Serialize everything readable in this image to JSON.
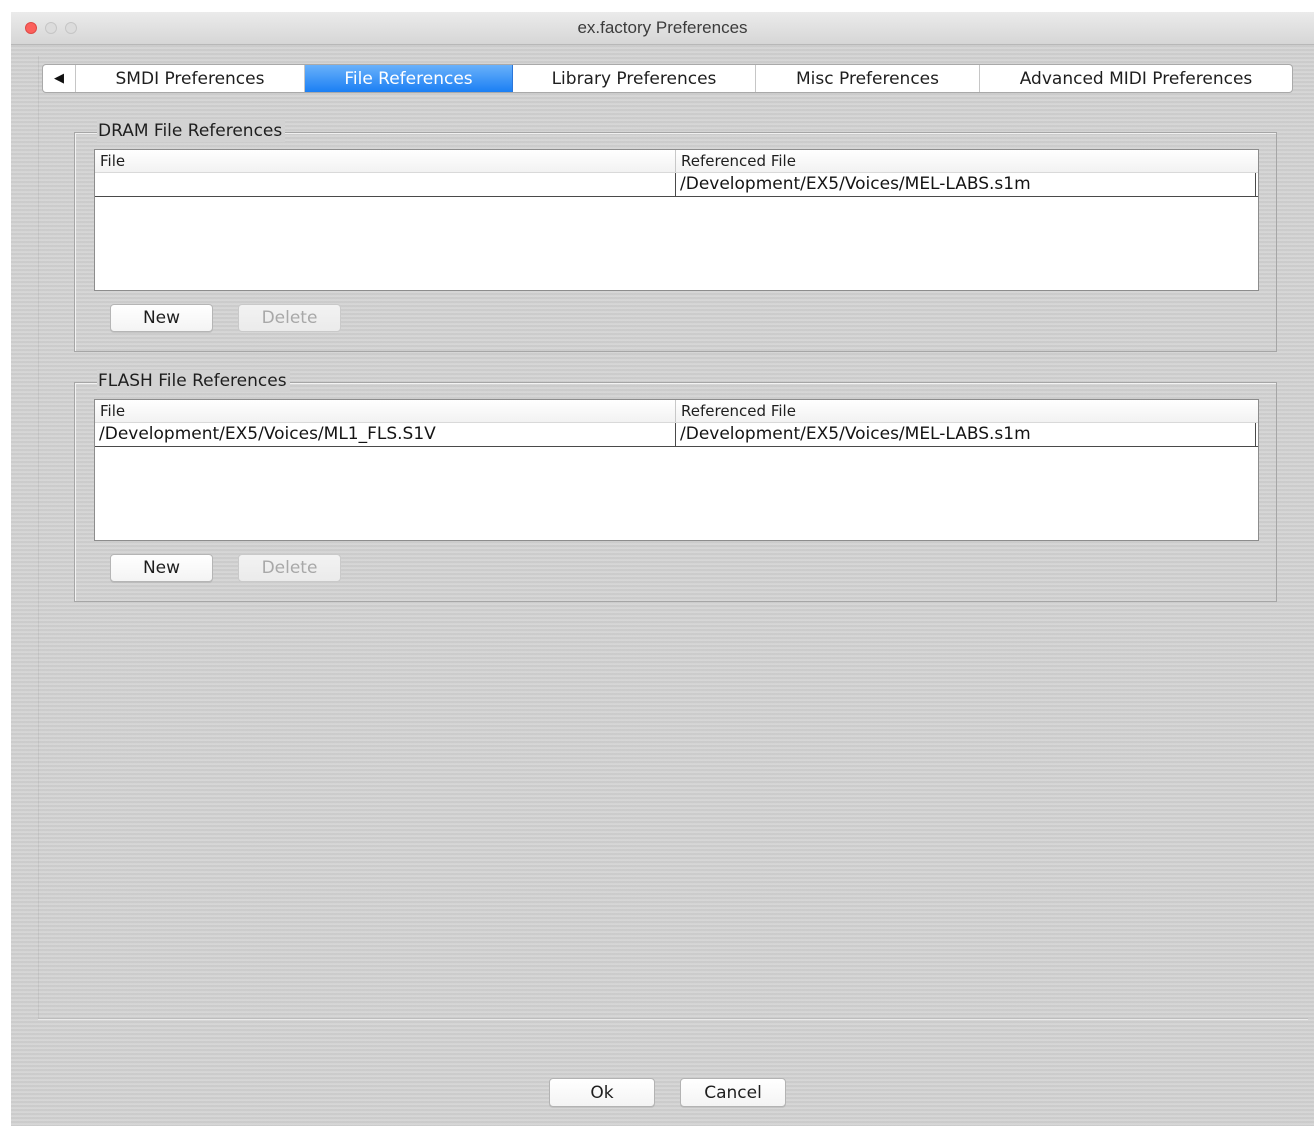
{
  "window": {
    "title": "ex.factory Preferences"
  },
  "tabs": {
    "scroll_left_glyph": "◀",
    "items": [
      {
        "label": "SMDI Preferences",
        "active": false
      },
      {
        "label": "File References",
        "active": true
      },
      {
        "label": "Library Preferences",
        "active": false
      },
      {
        "label": "Misc Preferences",
        "active": false
      },
      {
        "label": "Advanced MIDI Preferences",
        "active": false
      }
    ]
  },
  "dram": {
    "title": "DRAM File References",
    "columns": [
      "File",
      "Referenced File"
    ],
    "rows": [
      {
        "file": "",
        "referenced_file": "/Development/EX5/Voices/MEL-LABS.s1m"
      }
    ],
    "new_label": "New",
    "delete_label": "Delete",
    "delete_enabled": false
  },
  "flash": {
    "title": "FLASH File References",
    "columns": [
      "File",
      "Referenced File"
    ],
    "rows": [
      {
        "file": "/Development/EX5/Voices/ML1_FLS.S1V",
        "referenced_file": "/Development/EX5/Voices/MEL-LABS.s1m"
      }
    ],
    "new_label": "New",
    "delete_label": "Delete",
    "delete_enabled": false
  },
  "footer": {
    "ok_label": "Ok",
    "cancel_label": "Cancel"
  },
  "colors": {
    "active_tab": "#1b7ff4",
    "close_button": "#fc605c",
    "window_background": "#d2d2d2"
  }
}
